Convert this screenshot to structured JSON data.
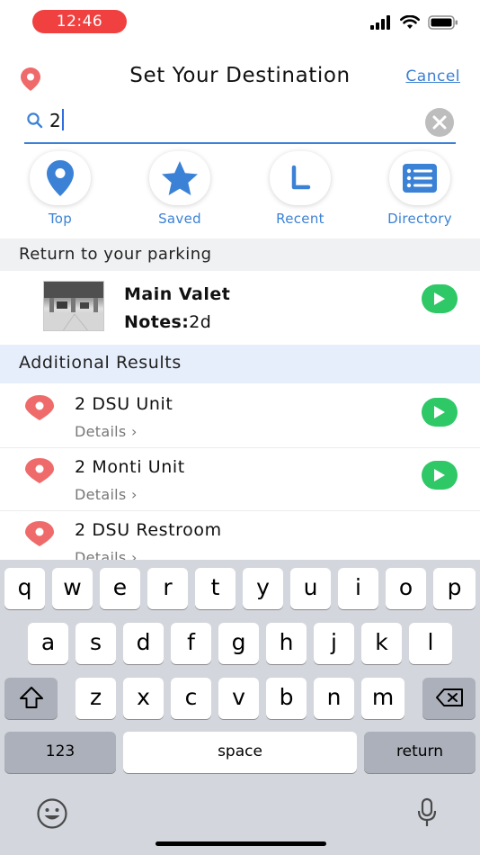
{
  "status_bar": {
    "time": "12:46",
    "time_pill_color": "#f04040"
  },
  "header": {
    "title": "Set Your Destination",
    "cancel_label": "Cancel",
    "pin_icon": "location-pin-icon"
  },
  "search": {
    "value": "2",
    "clear_icon": "clear-icon",
    "search_icon": "search-icon"
  },
  "quick_tabs": [
    {
      "label": "Top",
      "icon": "location-pin-icon"
    },
    {
      "label": "Saved",
      "icon": "star-icon"
    },
    {
      "label": "Recent",
      "icon": "recent-icon"
    },
    {
      "label": "Directory",
      "icon": "directory-list-icon"
    }
  ],
  "parking_section": {
    "heading": "Return to your parking",
    "item": {
      "name": "Main Valet",
      "notes_label": "Notes:",
      "notes_value": "2d"
    }
  },
  "results_section": {
    "heading": "Additional Results",
    "items": [
      {
        "name": "2 DSU Unit",
        "details": "Details ›"
      },
      {
        "name": "2 Monti Unit",
        "details": "Details ›"
      },
      {
        "name": "2 DSU Restroom",
        "details": "Details ›"
      }
    ]
  },
  "keyboard": {
    "row1": [
      "q",
      "w",
      "e",
      "r",
      "t",
      "y",
      "u",
      "i",
      "o",
      "p"
    ],
    "row2": [
      "a",
      "s",
      "d",
      "f",
      "g",
      "h",
      "j",
      "k",
      "l"
    ],
    "row3": [
      "z",
      "x",
      "c",
      "v",
      "b",
      "n",
      "m"
    ],
    "numbers_key": "123",
    "space_key": "space",
    "return_key": "return"
  },
  "colors": {
    "accent": "#3b82d6",
    "go_green": "#2ec866",
    "pin_red": "#ef6b6b",
    "blue_section": "#e6eefb"
  }
}
